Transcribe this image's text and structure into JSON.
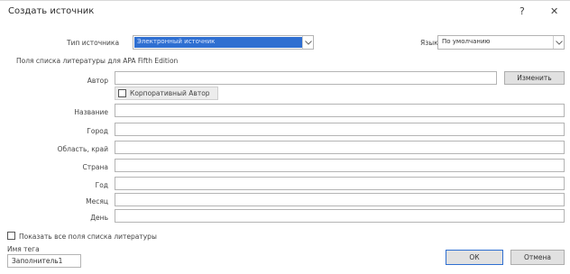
{
  "dialog": {
    "title": "Создать источник",
    "help_glyph": "?",
    "close_glyph": "✕"
  },
  "source_type": {
    "label": "Тип источника",
    "value": "Электронный источник"
  },
  "language": {
    "label": "Язык",
    "value": "По умолчанию"
  },
  "section_caption": "Поля списка литературы для APA Fifth Edition",
  "author": {
    "label": "Автор",
    "value": "",
    "edit_button": "Изменить",
    "corporate_label": "Корпоративный Автор"
  },
  "fields": [
    {
      "label": "Название",
      "value": ""
    },
    {
      "label": "Город",
      "value": ""
    },
    {
      "label": "Область, край",
      "value": ""
    },
    {
      "label": "Страна",
      "value": ""
    },
    {
      "label": "Год",
      "value": ""
    },
    {
      "label": "Месяц",
      "value": ""
    },
    {
      "label": "День",
      "value": ""
    }
  ],
  "show_all": {
    "label": "Показать все поля списка литературы"
  },
  "tag": {
    "label": "Имя тега",
    "value": "Заполнитель1"
  },
  "buttons": {
    "ok": "ОК",
    "cancel": "Отмена"
  },
  "colors": {
    "accent": "#2f6fd1",
    "border": "#b4b4b4"
  }
}
